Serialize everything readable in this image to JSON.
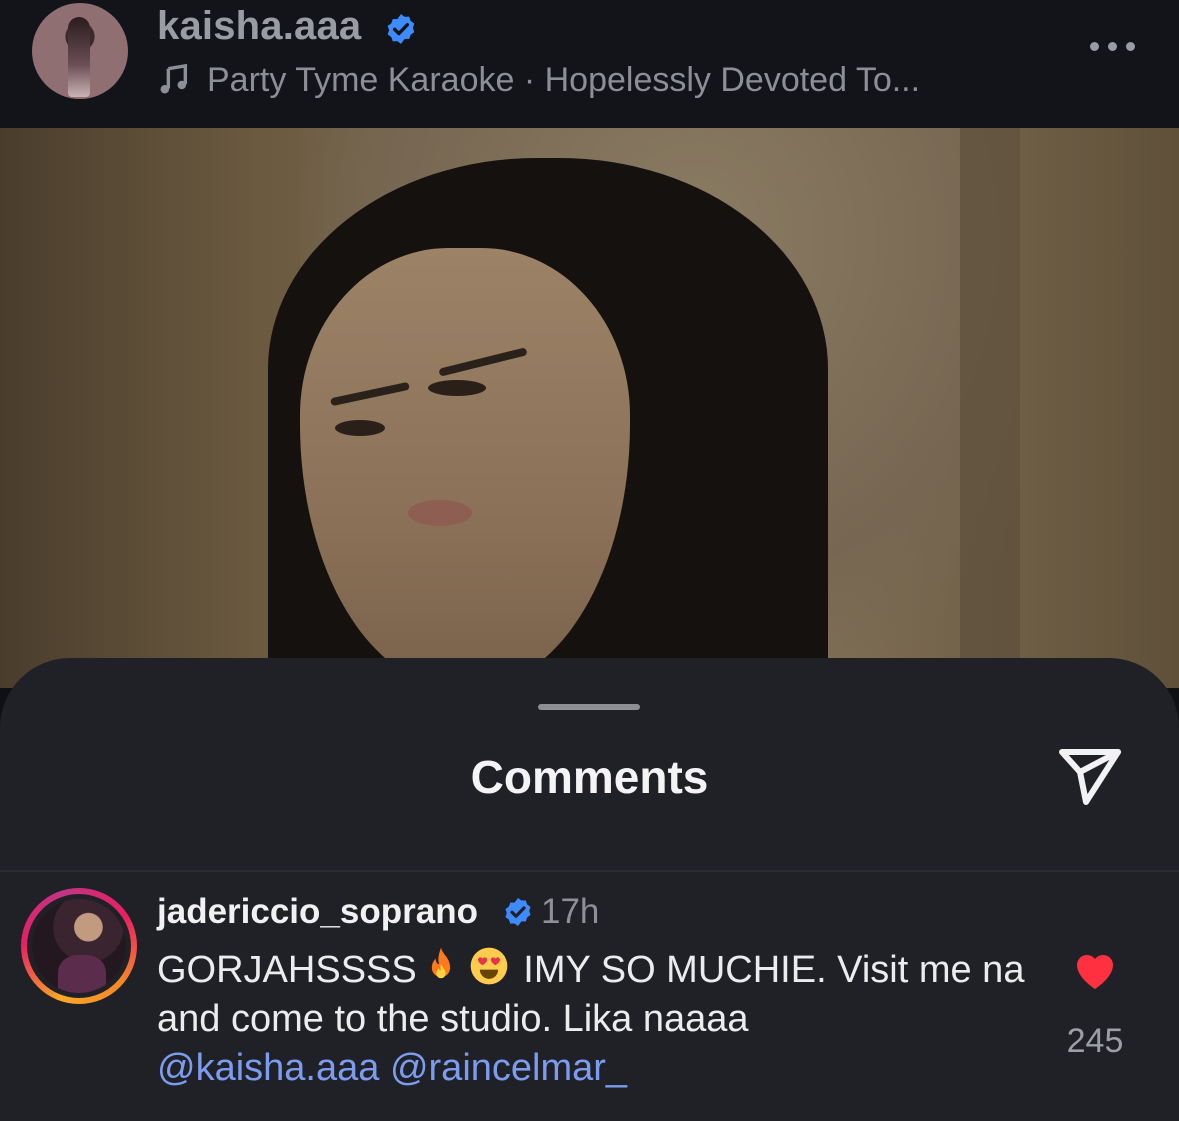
{
  "header": {
    "username": "kaisha.aaa",
    "music": "Party Tyme Karaoke · Hopelessly Devoted To..."
  },
  "sheet": {
    "title": "Comments"
  },
  "comment": {
    "username": "jadericcio_soprano",
    "time": "17h",
    "text_part1": "GORJAHSSSS",
    "text_part2": " IMY SO MUCHIE. Visit me na and come to the studio. Lika naaaa ",
    "mention1": "@kaisha.aaa",
    "mention2": "@raincelmar_",
    "likes": "245"
  },
  "colors": {
    "verified_blue": "#3d8bfd",
    "heart_red": "#ff3040",
    "mention_blue": "#7c9cf0"
  }
}
